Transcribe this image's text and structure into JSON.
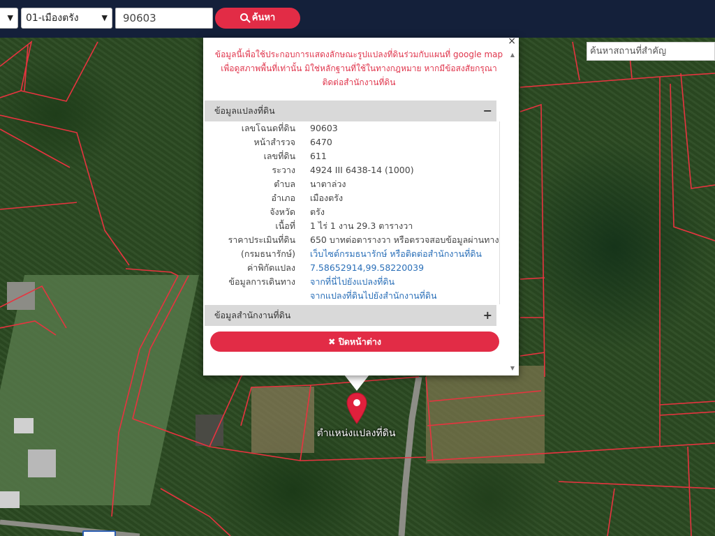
{
  "topbar": {
    "province_select": {
      "value": ""
    },
    "district_select": {
      "value": "01-เมืองตรัง"
    },
    "parcel_input": {
      "value": "90603"
    },
    "search_button": {
      "label": "ค้นหา"
    }
  },
  "place_search": {
    "placeholder": "ค้นหาสถานที่สำคัญ"
  },
  "popup": {
    "close": "×",
    "disclaimer": "ข้อมูลนี้เพื่อใช้ประกอบการแสดงลักษณะรูปแปลงที่ดินร่วมกับแผนที่ google map เพื่อดูสภาพพื้นที่เท่านั้น มิใช่หลักฐานที่ใช้ในทางกฎหมาย หากมีข้อสงสัยกรุณาติดต่อสำนักงานที่ดิน",
    "parcel_section": {
      "title": "ข้อมูลแปลงที่ดิน",
      "toggle": "−",
      "rows": [
        {
          "label": "เลขโฉนดที่ดิน",
          "value": "90603"
        },
        {
          "label": "หน้าสำรวจ",
          "value": "6470"
        },
        {
          "label": "เลขที่ดิน",
          "value": "611"
        },
        {
          "label": "ระวาง",
          "value": "4924 III 6438-14 (1000)"
        },
        {
          "label": "ตำบล",
          "value": "นาตาล่วง"
        },
        {
          "label": "อำเภอ",
          "value": "เมืองตรัง"
        },
        {
          "label": "จังหวัด",
          "value": "ตรัง"
        },
        {
          "label": "เนื้อที่",
          "value": "1 ไร่ 1 งาน 29.3 ตารางวา"
        },
        {
          "label": "ราคาประเมินที่ดิน",
          "value": "650 บาทต่อตารางวา หรือตรวจสอบข้อมูลผ่านทาง"
        },
        {
          "label": "(กรมธนารักษ์)",
          "value": "เว็บไซต์กรมธนารักษ์ หรือติดต่อสำนักงานที่ดิน"
        },
        {
          "label": "ค่าพิกัดแปลง",
          "value": "7.58652914,99.58220039"
        },
        {
          "label": "ข้อมูลการเดินทาง",
          "value": "จากที่นี่ไปยังแปลงที่ดิน"
        },
        {
          "label": "",
          "value": "จากแปลงที่ดินไปยังสำนักงานที่ดิน"
        }
      ]
    },
    "office_section": {
      "title": "ข้อมูลสำนักงานที่ดิน",
      "toggle": "+"
    },
    "close_button": {
      "label": "ปิดหน้าต่าง"
    }
  },
  "map": {
    "marker_label": "ตำแหน่งแปลงที่ดิน"
  },
  "colors": {
    "topbar": "#14203a",
    "accent": "#e22c46",
    "parcel_line": "#e8333f",
    "link": "#2a6fb8"
  }
}
